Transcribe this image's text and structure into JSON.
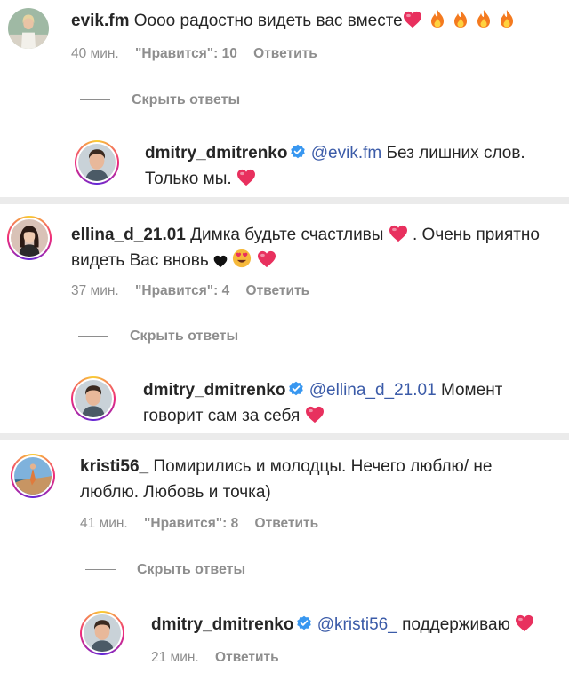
{
  "comments": [
    {
      "username": "evik.fm",
      "text": "Оооо радостно видеть вас вместе",
      "time": "40 мин.",
      "likes": "\"Нравится\": 10",
      "reply": "Ответить",
      "hide_replies": "Скрыть ответы",
      "replies": [
        {
          "username": "dmitry_dmitrenko",
          "mention": "@evik.fm",
          "text_line1": "Без лишних слов.",
          "text_line2": "Только мы."
        }
      ]
    },
    {
      "username": "ellina_d_21.01",
      "text_line1": "Димка будьте счастливы",
      "text_line1_end": ". Очень приятно",
      "text_line2": "видеть Вас вновь",
      "time": "37 мин.",
      "likes": "\"Нравится\": 4",
      "reply": "Ответить",
      "hide_replies": "Скрыть ответы",
      "replies": [
        {
          "username": "dmitry_dmitrenko",
          "mention": "@ellina_d_21.01",
          "text_line1": "Момент",
          "text_line2": "говорит сам за себя"
        }
      ]
    },
    {
      "username": "kristi56_",
      "text_line1": "Помирились и молодцы. Нечего люблю/ не",
      "text_line2": "люблю. Любовь и точка)",
      "time": "41 мин.",
      "likes": "\"Нравится\": 8",
      "reply": "Ответить",
      "hide_replies": "Скрыть ответы",
      "replies": [
        {
          "username": "dmitry_dmitrenko",
          "mention": "@kristi56_",
          "text_line1": "поддерживаю",
          "time": "21 мин.",
          "reply": "Ответить"
        }
      ]
    }
  ],
  "colors": {
    "heart": "#e8305e",
    "fire": "#f47a1f",
    "verified": "#3897f0",
    "mention": "#3b5ba8",
    "meta": "#8e8e8e"
  }
}
